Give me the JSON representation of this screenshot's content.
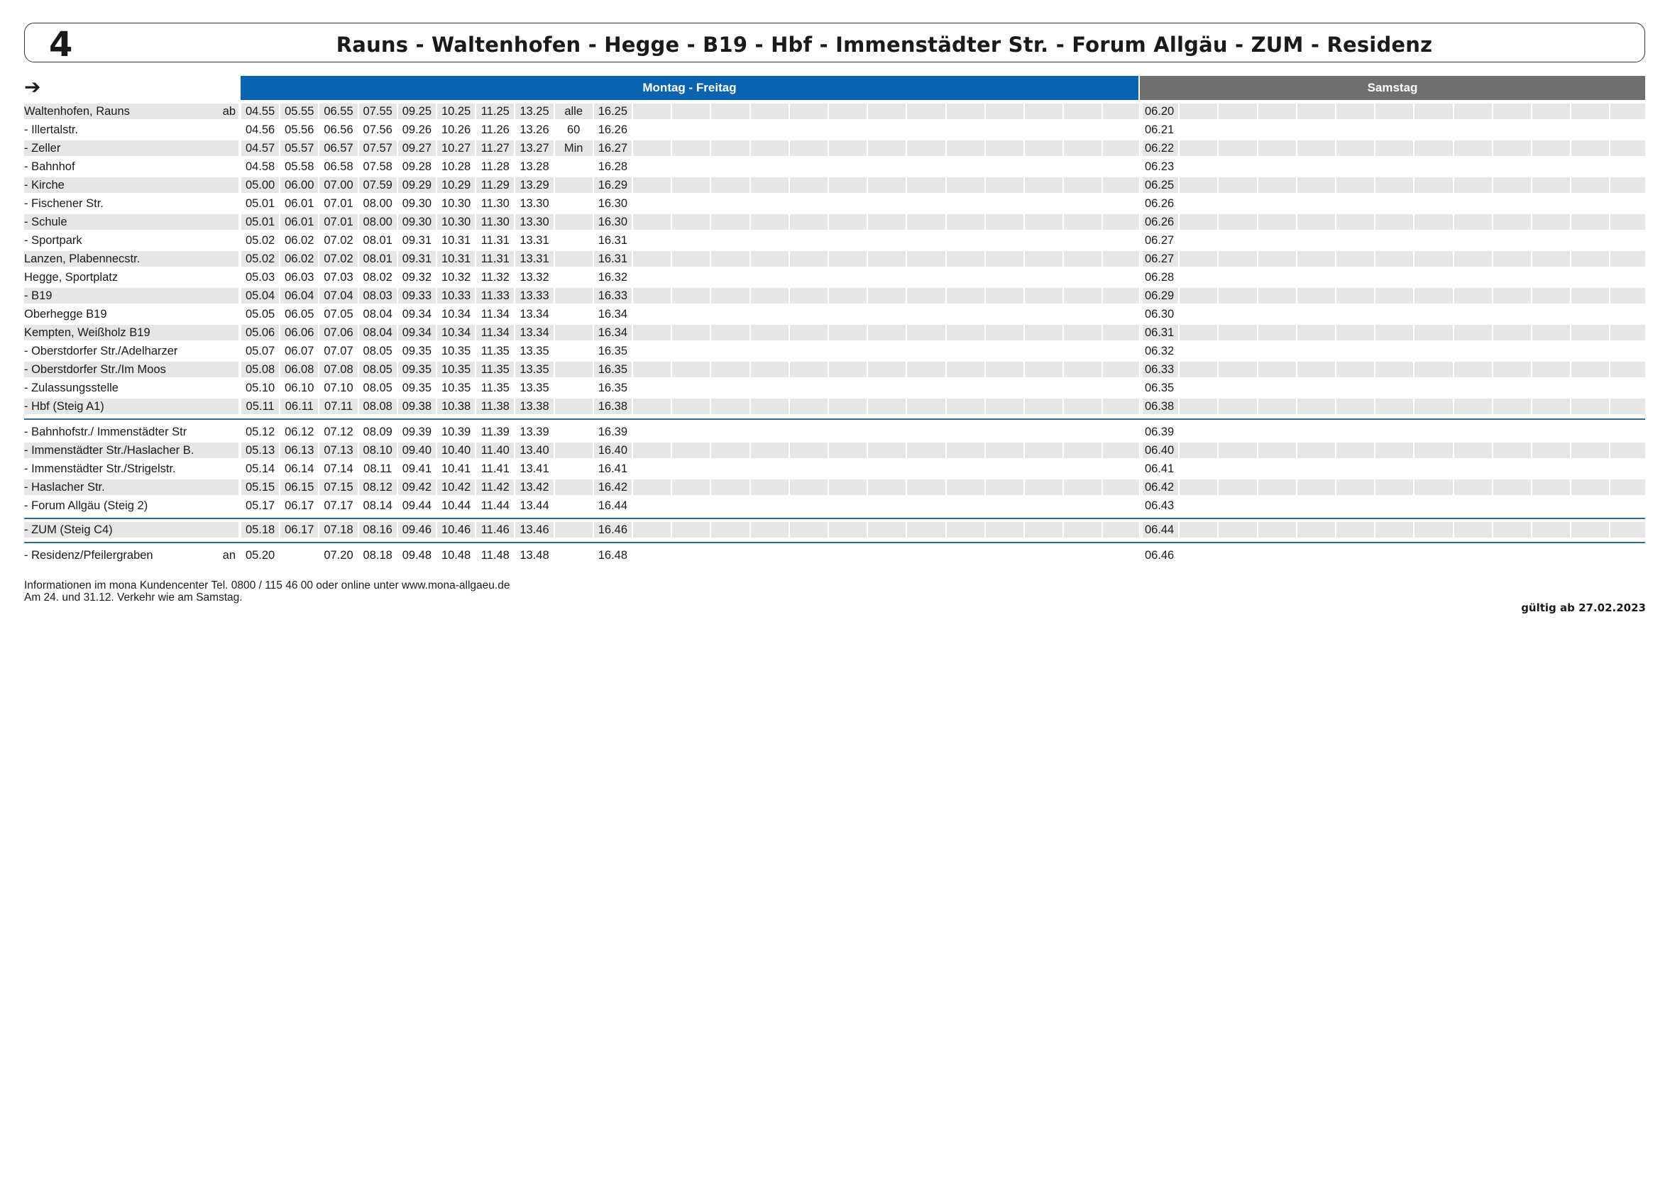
{
  "header": {
    "line_number": "4",
    "route_title": "Rauns - Waltenhofen - Hegge - B19 - Hbf - Immenstädter Str. - Forum Allgäu - ZUM - Residenz",
    "direction_arrow": "➔"
  },
  "bands": {
    "weekday": "Montag - Freitag",
    "saturday": "Samstag"
  },
  "stops": [
    {
      "name": "Waltenhofen, Rauns",
      "mark": "ab",
      "weekday": [
        "04.55",
        "05.55",
        "06.55",
        "07.55",
        "09.25",
        "10.25",
        "11.25",
        "13.25",
        "alle",
        "16.25"
      ],
      "saturday": [
        "06.20"
      ]
    },
    {
      "name": "- Illertalstr.",
      "mark": "",
      "weekday": [
        "04.56",
        "05.56",
        "06.56",
        "07.56",
        "09.26",
        "10.26",
        "11.26",
        "13.26",
        "60",
        "16.26"
      ],
      "saturday": [
        "06.21"
      ]
    },
    {
      "name": "- Zeller",
      "mark": "",
      "weekday": [
        "04.57",
        "05.57",
        "06.57",
        "07.57",
        "09.27",
        "10.27",
        "11.27",
        "13.27",
        "Min",
        "16.27"
      ],
      "saturday": [
        "06.22"
      ]
    },
    {
      "name": "- Bahnhof",
      "mark": "",
      "weekday": [
        "04.58",
        "05.58",
        "06.58",
        "07.58",
        "09.28",
        "10.28",
        "11.28",
        "13.28",
        "",
        "16.28"
      ],
      "saturday": [
        "06.23"
      ]
    },
    {
      "name": "- Kirche",
      "mark": "",
      "weekday": [
        "05.00",
        "06.00",
        "07.00",
        "07.59",
        "09.29",
        "10.29",
        "11.29",
        "13.29",
        "",
        "16.29"
      ],
      "saturday": [
        "06.25"
      ]
    },
    {
      "name": "- Fischener Str.",
      "mark": "",
      "weekday": [
        "05.01",
        "06.01",
        "07.01",
        "08.00",
        "09.30",
        "10.30",
        "11.30",
        "13.30",
        "",
        "16.30"
      ],
      "saturday": [
        "06.26"
      ]
    },
    {
      "name": "- Schule",
      "mark": "",
      "weekday": [
        "05.01",
        "06.01",
        "07.01",
        "08.00",
        "09.30",
        "10.30",
        "11.30",
        "13.30",
        "",
        "16.30"
      ],
      "saturday": [
        "06.26"
      ]
    },
    {
      "name": "- Sportpark",
      "mark": "",
      "weekday": [
        "05.02",
        "06.02",
        "07.02",
        "08.01",
        "09.31",
        "10.31",
        "11.31",
        "13.31",
        "",
        "16.31"
      ],
      "saturday": [
        "06.27"
      ]
    },
    {
      "name": "Lanzen, Plabennecstr.",
      "mark": "",
      "weekday": [
        "05.02",
        "06.02",
        "07.02",
        "08.01",
        "09.31",
        "10.31",
        "11.31",
        "13.31",
        "",
        "16.31"
      ],
      "saturday": [
        "06.27"
      ]
    },
    {
      "name": "Hegge, Sportplatz",
      "mark": "",
      "weekday": [
        "05.03",
        "06.03",
        "07.03",
        "08.02",
        "09.32",
        "10.32",
        "11.32",
        "13.32",
        "",
        "16.32"
      ],
      "saturday": [
        "06.28"
      ]
    },
    {
      "name": "- B19",
      "mark": "",
      "weekday": [
        "05.04",
        "06.04",
        "07.04",
        "08.03",
        "09.33",
        "10.33",
        "11.33",
        "13.33",
        "",
        "16.33"
      ],
      "saturday": [
        "06.29"
      ]
    },
    {
      "name": "Oberhegge B19",
      "mark": "",
      "weekday": [
        "05.05",
        "06.05",
        "07.05",
        "08.04",
        "09.34",
        "10.34",
        "11.34",
        "13.34",
        "",
        "16.34"
      ],
      "saturday": [
        "06.30"
      ]
    },
    {
      "name": "Kempten, Weißholz B19",
      "mark": "",
      "weekday": [
        "05.06",
        "06.06",
        "07.06",
        "08.04",
        "09.34",
        "10.34",
        "11.34",
        "13.34",
        "",
        "16.34"
      ],
      "saturday": [
        "06.31"
      ]
    },
    {
      "name": "- Oberstdorfer Str./Adelharzer",
      "mark": "",
      "weekday": [
        "05.07",
        "06.07",
        "07.07",
        "08.05",
        "09.35",
        "10.35",
        "11.35",
        "13.35",
        "",
        "16.35"
      ],
      "saturday": [
        "06.32"
      ]
    },
    {
      "name": "- Oberstdorfer Str./Im Moos",
      "mark": "",
      "weekday": [
        "05.08",
        "06.08",
        "07.08",
        "08.05",
        "09.35",
        "10.35",
        "11.35",
        "13.35",
        "",
        "16.35"
      ],
      "saturday": [
        "06.33"
      ]
    },
    {
      "name": "- Zulassungsstelle",
      "mark": "",
      "weekday": [
        "05.10",
        "06.10",
        "07.10",
        "08.05",
        "09.35",
        "10.35",
        "11.35",
        "13.35",
        "",
        "16.35"
      ],
      "saturday": [
        "06.35"
      ]
    },
    {
      "name": "- Hbf (Steig A1)",
      "mark": "",
      "weekday": [
        "05.11",
        "06.11",
        "07.11",
        "08.08",
        "09.38",
        "10.38",
        "11.38",
        "13.38",
        "",
        "16.38"
      ],
      "saturday": [
        "06.38"
      ]
    },
    {
      "name": "- Bahnhofstr./ Immenstädter Str",
      "mark": "",
      "weekday": [
        "05.12",
        "06.12",
        "07.12",
        "08.09",
        "09.39",
        "10.39",
        "11.39",
        "13.39",
        "",
        "16.39"
      ],
      "saturday": [
        "06.39"
      ]
    },
    {
      "name": "- Immenstädter Str./Haslacher B.",
      "mark": "",
      "weekday": [
        "05.13",
        "06.13",
        "07.13",
        "08.10",
        "09.40",
        "10.40",
        "11.40",
        "13.40",
        "",
        "16.40"
      ],
      "saturday": [
        "06.40"
      ]
    },
    {
      "name": "- Immenstädter Str./Strigelstr.",
      "mark": "",
      "weekday": [
        "05.14",
        "06.14",
        "07.14",
        "08.11",
        "09.41",
        "10.41",
        "11.41",
        "13.41",
        "",
        "16.41"
      ],
      "saturday": [
        "06.41"
      ]
    },
    {
      "name": "- Haslacher Str.",
      "mark": "",
      "weekday": [
        "05.15",
        "06.15",
        "07.15",
        "08.12",
        "09.42",
        "10.42",
        "11.42",
        "13.42",
        "",
        "16.42"
      ],
      "saturday": [
        "06.42"
      ]
    },
    {
      "name": "- Forum Allgäu (Steig 2)",
      "mark": "",
      "weekday": [
        "05.17",
        "06.17",
        "07.17",
        "08.14",
        "09.44",
        "10.44",
        "11.44",
        "13.44",
        "",
        "16.44"
      ],
      "saturday": [
        "06.43"
      ]
    },
    {
      "name": "- ZUM (Steig C4)",
      "mark": "",
      "weekday": [
        "05.18",
        "06.17",
        "07.18",
        "08.16",
        "09.46",
        "10.46",
        "11.46",
        "13.46",
        "",
        "16.46"
      ],
      "saturday": [
        "06.44"
      ]
    },
    {
      "name": "- Residenz/Pfeilergraben",
      "mark": "an",
      "weekday": [
        "05.20",
        "",
        "07.20",
        "08.18",
        "09.48",
        "10.48",
        "11.48",
        "13.48",
        "",
        "16.48"
      ],
      "saturday": [
        "06.46"
      ]
    }
  ],
  "footer": {
    "info_line": "Informationen im mona Kundencenter Tel. 0800 / 115 46 00 oder online unter www.mona-allgaeu.de",
    "holiday_note": "Am 24. und 31.12. Verkehr wie am Samstag.",
    "validity": "gültig ab 27.02.2023"
  }
}
